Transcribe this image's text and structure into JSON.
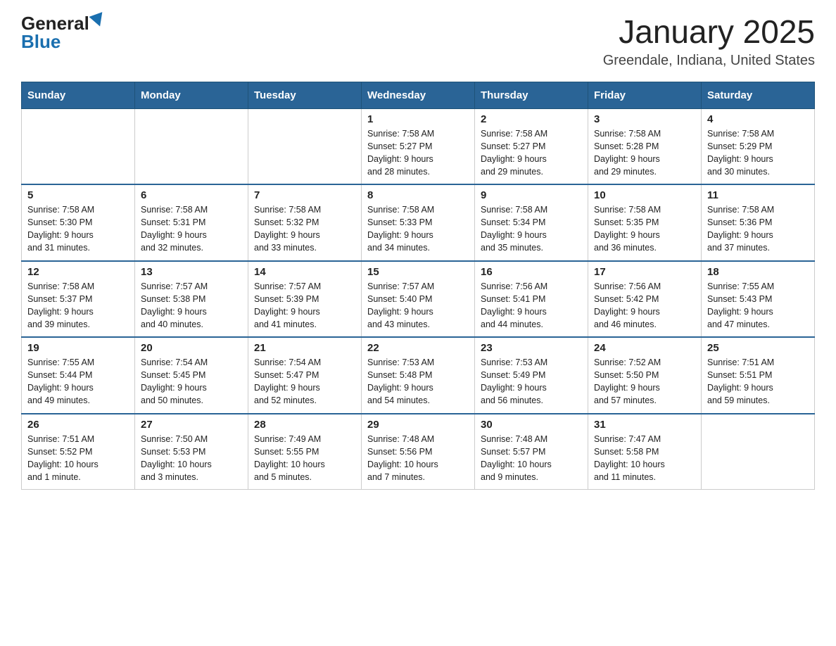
{
  "logo": {
    "general": "General",
    "blue": "Blue"
  },
  "title": "January 2025",
  "subtitle": "Greendale, Indiana, United States",
  "days_of_week": [
    "Sunday",
    "Monday",
    "Tuesday",
    "Wednesday",
    "Thursday",
    "Friday",
    "Saturday"
  ],
  "weeks": [
    [
      {
        "day": "",
        "info": ""
      },
      {
        "day": "",
        "info": ""
      },
      {
        "day": "",
        "info": ""
      },
      {
        "day": "1",
        "info": "Sunrise: 7:58 AM\nSunset: 5:27 PM\nDaylight: 9 hours\nand 28 minutes."
      },
      {
        "day": "2",
        "info": "Sunrise: 7:58 AM\nSunset: 5:27 PM\nDaylight: 9 hours\nand 29 minutes."
      },
      {
        "day": "3",
        "info": "Sunrise: 7:58 AM\nSunset: 5:28 PM\nDaylight: 9 hours\nand 29 minutes."
      },
      {
        "day": "4",
        "info": "Sunrise: 7:58 AM\nSunset: 5:29 PM\nDaylight: 9 hours\nand 30 minutes."
      }
    ],
    [
      {
        "day": "5",
        "info": "Sunrise: 7:58 AM\nSunset: 5:30 PM\nDaylight: 9 hours\nand 31 minutes."
      },
      {
        "day": "6",
        "info": "Sunrise: 7:58 AM\nSunset: 5:31 PM\nDaylight: 9 hours\nand 32 minutes."
      },
      {
        "day": "7",
        "info": "Sunrise: 7:58 AM\nSunset: 5:32 PM\nDaylight: 9 hours\nand 33 minutes."
      },
      {
        "day": "8",
        "info": "Sunrise: 7:58 AM\nSunset: 5:33 PM\nDaylight: 9 hours\nand 34 minutes."
      },
      {
        "day": "9",
        "info": "Sunrise: 7:58 AM\nSunset: 5:34 PM\nDaylight: 9 hours\nand 35 minutes."
      },
      {
        "day": "10",
        "info": "Sunrise: 7:58 AM\nSunset: 5:35 PM\nDaylight: 9 hours\nand 36 minutes."
      },
      {
        "day": "11",
        "info": "Sunrise: 7:58 AM\nSunset: 5:36 PM\nDaylight: 9 hours\nand 37 minutes."
      }
    ],
    [
      {
        "day": "12",
        "info": "Sunrise: 7:58 AM\nSunset: 5:37 PM\nDaylight: 9 hours\nand 39 minutes."
      },
      {
        "day": "13",
        "info": "Sunrise: 7:57 AM\nSunset: 5:38 PM\nDaylight: 9 hours\nand 40 minutes."
      },
      {
        "day": "14",
        "info": "Sunrise: 7:57 AM\nSunset: 5:39 PM\nDaylight: 9 hours\nand 41 minutes."
      },
      {
        "day": "15",
        "info": "Sunrise: 7:57 AM\nSunset: 5:40 PM\nDaylight: 9 hours\nand 43 minutes."
      },
      {
        "day": "16",
        "info": "Sunrise: 7:56 AM\nSunset: 5:41 PM\nDaylight: 9 hours\nand 44 minutes."
      },
      {
        "day": "17",
        "info": "Sunrise: 7:56 AM\nSunset: 5:42 PM\nDaylight: 9 hours\nand 46 minutes."
      },
      {
        "day": "18",
        "info": "Sunrise: 7:55 AM\nSunset: 5:43 PM\nDaylight: 9 hours\nand 47 minutes."
      }
    ],
    [
      {
        "day": "19",
        "info": "Sunrise: 7:55 AM\nSunset: 5:44 PM\nDaylight: 9 hours\nand 49 minutes."
      },
      {
        "day": "20",
        "info": "Sunrise: 7:54 AM\nSunset: 5:45 PM\nDaylight: 9 hours\nand 50 minutes."
      },
      {
        "day": "21",
        "info": "Sunrise: 7:54 AM\nSunset: 5:47 PM\nDaylight: 9 hours\nand 52 minutes."
      },
      {
        "day": "22",
        "info": "Sunrise: 7:53 AM\nSunset: 5:48 PM\nDaylight: 9 hours\nand 54 minutes."
      },
      {
        "day": "23",
        "info": "Sunrise: 7:53 AM\nSunset: 5:49 PM\nDaylight: 9 hours\nand 56 minutes."
      },
      {
        "day": "24",
        "info": "Sunrise: 7:52 AM\nSunset: 5:50 PM\nDaylight: 9 hours\nand 57 minutes."
      },
      {
        "day": "25",
        "info": "Sunrise: 7:51 AM\nSunset: 5:51 PM\nDaylight: 9 hours\nand 59 minutes."
      }
    ],
    [
      {
        "day": "26",
        "info": "Sunrise: 7:51 AM\nSunset: 5:52 PM\nDaylight: 10 hours\nand 1 minute."
      },
      {
        "day": "27",
        "info": "Sunrise: 7:50 AM\nSunset: 5:53 PM\nDaylight: 10 hours\nand 3 minutes."
      },
      {
        "day": "28",
        "info": "Sunrise: 7:49 AM\nSunset: 5:55 PM\nDaylight: 10 hours\nand 5 minutes."
      },
      {
        "day": "29",
        "info": "Sunrise: 7:48 AM\nSunset: 5:56 PM\nDaylight: 10 hours\nand 7 minutes."
      },
      {
        "day": "30",
        "info": "Sunrise: 7:48 AM\nSunset: 5:57 PM\nDaylight: 10 hours\nand 9 minutes."
      },
      {
        "day": "31",
        "info": "Sunrise: 7:47 AM\nSunset: 5:58 PM\nDaylight: 10 hours\nand 11 minutes."
      },
      {
        "day": "",
        "info": ""
      }
    ]
  ]
}
